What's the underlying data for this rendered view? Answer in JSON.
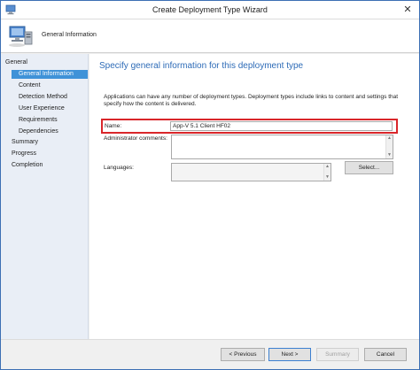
{
  "window": {
    "title": "Create Deployment Type Wizard",
    "close_glyph": "✕"
  },
  "header": {
    "page_name": "General Information"
  },
  "sidebar": {
    "items": [
      {
        "label": "General",
        "level": 0,
        "active": false
      },
      {
        "label": "General Information",
        "level": 1,
        "active": true
      },
      {
        "label": "Content",
        "level": 1,
        "active": false
      },
      {
        "label": "Detection Method",
        "level": 1,
        "active": false
      },
      {
        "label": "User Experience",
        "level": 1,
        "active": false
      },
      {
        "label": "Requirements",
        "level": 1,
        "active": false
      },
      {
        "label": "Dependencies",
        "level": 1,
        "active": false
      },
      {
        "label": "Summary",
        "level": 0,
        "active": false
      },
      {
        "label": "Progress",
        "level": 0,
        "active": false
      },
      {
        "label": "Completion",
        "level": 0,
        "active": false
      }
    ]
  },
  "main": {
    "heading": "Specify general information for this deployment type",
    "description": "Applications can have any number of deployment types. Deployment types include links to content and settings that specify how the content is delivered.",
    "name_label": "Name:",
    "name_value": "App-V 5.1 Client HF02",
    "admin_comments_label": "Administrator comments:",
    "admin_comments_value": "",
    "languages_label": "Languages:",
    "languages_value": "",
    "select_button": "Select..."
  },
  "footer": {
    "previous": "< Previous",
    "next": "Next >",
    "summary": "Summary",
    "cancel": "Cancel"
  },
  "colors": {
    "accent": "#3f92d8",
    "heading": "#2d6bb7",
    "highlight": "#d9262a"
  },
  "icons": {
    "app": "computer-icon",
    "header": "computer-network-icon"
  }
}
